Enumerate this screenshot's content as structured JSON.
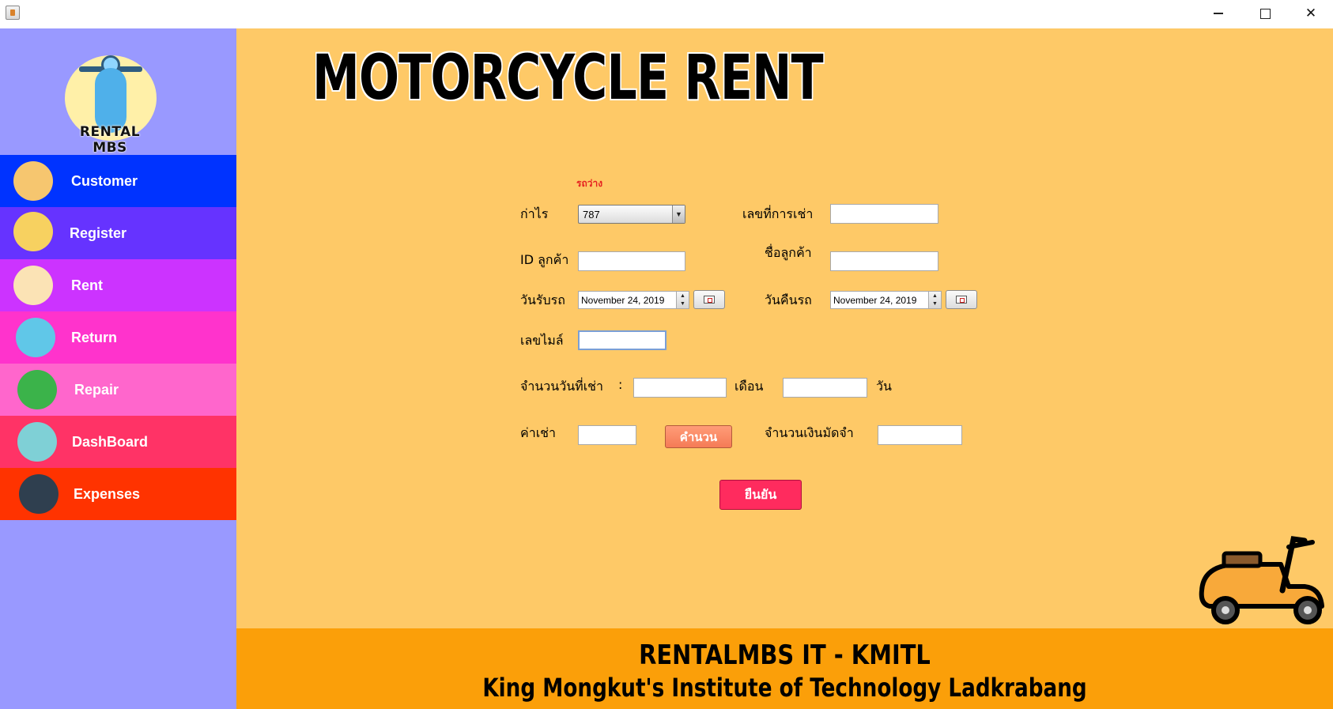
{
  "window": {
    "app_icon": "java-cup-icon",
    "controls": [
      "minimize-icon",
      "maximize-icon",
      "close-icon"
    ]
  },
  "sidebar": {
    "logo_text": "RENTAL MBS",
    "items": [
      {
        "label": "Customer",
        "icon": "customers-icon",
        "color": "#0033ff"
      },
      {
        "label": "Register",
        "icon": "register-scooter-icon",
        "color": "#6633ff"
      },
      {
        "label": "Rent",
        "icon": "rent-counter-icon",
        "color": "#cc33ff"
      },
      {
        "label": "Return",
        "icon": "return-scooter-icon",
        "color": "#ff33cc"
      },
      {
        "label": "Repair",
        "icon": "wrench-screwdriver-icon",
        "color": "#ff66cc"
      },
      {
        "label": "DashBoard",
        "icon": "dashboard-chart-icon",
        "color": "#ff3366"
      },
      {
        "label": "Expenses",
        "icon": "expenses-wallet-icon",
        "color": "#ff3300"
      }
    ],
    "background": "#9999ff"
  },
  "main": {
    "title": "MOTORCYCLE RENT",
    "background": "#fec967"
  },
  "form": {
    "status_text": "รถว่าง",
    "plate_label": "ก่าไร",
    "plate_value": "787",
    "rent_no_label": "เลขที่การเช่า",
    "rent_no_value": "",
    "customer_id_label": "ID ลูกค้า",
    "customer_id_value": "",
    "customer_name_label": "ชื่อลูกค้า",
    "customer_name_value": "",
    "pickup_label": "วันรับรถ",
    "pickup_date": "November 24, 2019",
    "return_label": "วันคืนรถ",
    "return_date": "November 24, 2019",
    "mileage_label": "เลขไมล์",
    "mileage_value": "",
    "days_label": "จำนวนวันที่เช่า",
    "days_colon": ":",
    "months_value": "",
    "month_unit": "เดือน",
    "days_value": "",
    "day_unit": "วัน",
    "rent_label": "ค่าเช่า",
    "rent_value": "",
    "calc_button": "คำนวน",
    "deposit_label": "จำนวนเงินมัดจำ",
    "deposit_value": "",
    "confirm_button": "ยืนยัน"
  },
  "decor": {
    "scooter_icon": "scooter-icon"
  },
  "footer": {
    "line1": "RENTALMBS IT - KMITL",
    "line2": "King Mongkut's Institute of  Technology Ladkrabang",
    "background": "#fb9f09"
  }
}
